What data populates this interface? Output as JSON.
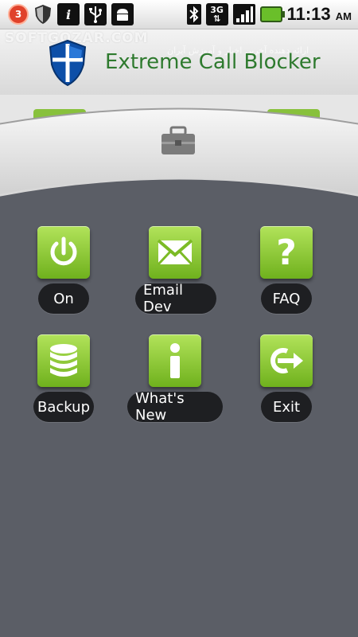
{
  "status_bar": {
    "notification_count": "3",
    "network_label": "3G",
    "time": "11:13",
    "ampm": "AM",
    "icons": [
      "notification-badge-icon",
      "shield-icon",
      "info-icon",
      "usb-icon",
      "android-icon",
      "bluetooth-icon",
      "3g-data-icon",
      "signal-icon",
      "battery-icon"
    ]
  },
  "header": {
    "title": "Extreme Call Blocker",
    "watermark": "SOFTGOZAR.COM",
    "watermark_sub": "ارائه دهنده آخرین اخبار و آموزش آیران"
  },
  "menu": {
    "items": [
      {
        "label": "On",
        "icon": "power-icon"
      },
      {
        "label": "Email Dev",
        "icon": "envelope-icon"
      },
      {
        "label": "FAQ",
        "icon": "question-icon"
      },
      {
        "label": "Backup",
        "icon": "database-icon"
      },
      {
        "label": "What's New",
        "icon": "info-icon"
      },
      {
        "label": "Exit",
        "icon": "exit-icon"
      }
    ]
  },
  "colors": {
    "accent_green": "#8cc63f",
    "title_green": "#2e7a2e",
    "background": "#5b5e66",
    "pill": "#1e1f22"
  }
}
